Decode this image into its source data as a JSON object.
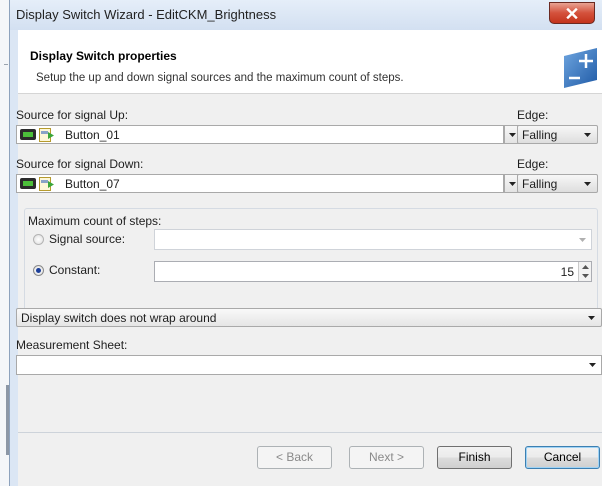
{
  "window": {
    "title": "Display Switch Wizard - EditCKM_Brightness"
  },
  "header": {
    "title": "Display Switch properties",
    "subtitle": "Setup the up and down signal sources and the maximum count of steps."
  },
  "signal_up": {
    "label": "Source for signal Up:",
    "value": "Button_01",
    "edge_label": "Edge:",
    "edge_value": "Falling"
  },
  "signal_down": {
    "label": "Source for signal Down:",
    "value": "Button_07",
    "edge_label": "Edge:",
    "edge_value": "Falling"
  },
  "max_steps": {
    "group_label": "Maximum count of steps:",
    "signal_source_label": "Signal source:",
    "signal_source_value": "",
    "constant_label": "Constant:",
    "constant_value": "15",
    "selected": "constant"
  },
  "wrap_mode": {
    "value": "Display switch does not wrap around"
  },
  "measurement_sheet": {
    "label": "Measurement Sheet:",
    "value": ""
  },
  "buttons": {
    "back": "< Back",
    "next": "Next >",
    "finish": "Finish",
    "cancel": "Cancel"
  },
  "icons": {
    "close": "close-icon",
    "wizard_logo": "wizard-plus-icon",
    "signal_device": "signal-device-icon",
    "button_signal": "button-signal-icon",
    "dropdown": "chevron-down-icon",
    "spin": "spin-arrows-icon"
  },
  "colors": {
    "title_bar": "#dbe6f4",
    "close_button": "#c3331c",
    "logo_blue": "#2e6ab1",
    "dialog_background": "#f0f0f0"
  }
}
